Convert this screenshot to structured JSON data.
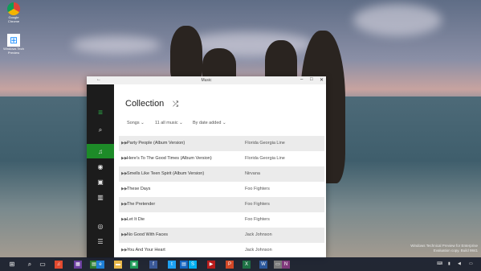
{
  "desktop": {
    "icons": [
      {
        "label": "Google Chrome"
      },
      {
        "label": "Windows Tech Preview"
      }
    ]
  },
  "window": {
    "title": "Music",
    "controls": {
      "minimize": "–",
      "maximize": "□",
      "close": "✕"
    }
  },
  "sidebar": {
    "items": [
      {
        "name": "menu",
        "glyph": "≡"
      },
      {
        "name": "search",
        "glyph": "⌕"
      },
      {
        "name": "collection",
        "glyph": "♫"
      },
      {
        "name": "radio",
        "glyph": "◉"
      },
      {
        "name": "playlists",
        "glyph": "▣"
      },
      {
        "name": "charts",
        "glyph": "▥"
      },
      {
        "name": "now-playing",
        "glyph": "◎"
      },
      {
        "name": "queue",
        "glyph": "☰"
      }
    ]
  },
  "main": {
    "heading": "Collection",
    "shuffle_glyph": "⤮",
    "filters": {
      "type": "Songs",
      "source": "11 all music",
      "sort": "By date added"
    },
    "songs": [
      {
        "title": "Party People (Album Version)",
        "artist": "Florida Georgia Line"
      },
      {
        "title": "Here's To The Good Times (Album Version)",
        "artist": "Florida Georgia Line"
      },
      {
        "title": "Smells Like Teen Spirit (Album Version)",
        "artist": "Nirvana"
      },
      {
        "title": "These Days",
        "artist": "Foo Fighters"
      },
      {
        "title": "The Pretender",
        "artist": "Foo Fighters"
      },
      {
        "title": "Let It Die",
        "artist": "Foo Fighters"
      },
      {
        "title": "No Good With Faces",
        "artist": "Jack Johnson"
      },
      {
        "title": "You And Your Heart",
        "artist": "Jack Johnson"
      }
    ]
  },
  "watermark": {
    "line1": "Windows Technical Preview for Enterprise",
    "line2": "Evaluation copy. Build 9841"
  },
  "taskbar": {
    "items": [
      {
        "name": "start",
        "glyph": "⊞",
        "color": "#ffffff"
      },
      {
        "name": "search",
        "glyph": "⌕",
        "color": "#ffffff"
      },
      {
        "name": "task-view",
        "glyph": "▭",
        "color": "#ffffff"
      },
      {
        "name": "music",
        "glyph": "♫",
        "color": "#e24a2f"
      },
      {
        "name": "app-purple",
        "glyph": "▦",
        "color": "#6b3fa0"
      },
      {
        "name": "store",
        "glyph": "▤",
        "color": "#2d7d32"
      },
      {
        "name": "internet-explorer",
        "glyph": "e",
        "color": "#1e7fd6"
      },
      {
        "name": "file-explorer",
        "glyph": "▬",
        "color": "#e8b84a"
      },
      {
        "name": "store-bag",
        "glyph": "▣",
        "color": "#1e9c58"
      },
      {
        "name": "facebook",
        "glyph": "f",
        "color": "#3b5998"
      },
      {
        "name": "twitter",
        "glyph": "t",
        "color": "#1da1f2"
      },
      {
        "name": "photos",
        "glyph": "▤",
        "color": "#1565c0"
      },
      {
        "name": "skype",
        "glyph": "S",
        "color": "#00aff0"
      },
      {
        "name": "video",
        "glyph": "▶",
        "color": "#b71c1c"
      },
      {
        "name": "powerpoint",
        "glyph": "P",
        "color": "#d24726"
      },
      {
        "name": "excel",
        "glyph": "X",
        "color": "#1e7145"
      },
      {
        "name": "word",
        "glyph": "W",
        "color": "#2b579a"
      },
      {
        "name": "pdf",
        "glyph": "▭",
        "color": "#7a7a7a"
      },
      {
        "name": "onenote",
        "glyph": "N",
        "color": "#80397b"
      }
    ]
  }
}
